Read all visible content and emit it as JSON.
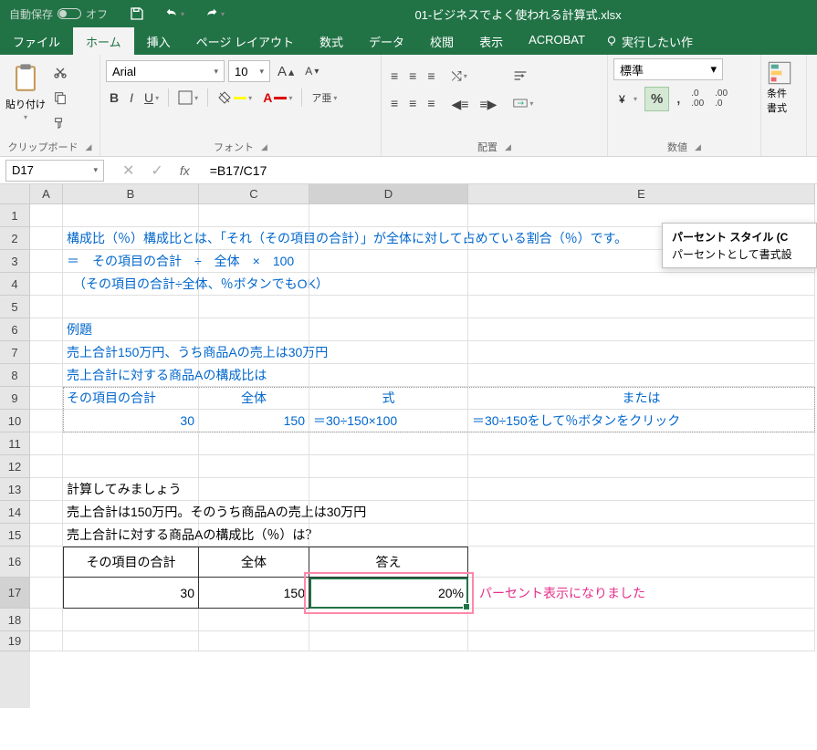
{
  "title_bar": {
    "autosave_label": "自動保存",
    "autosave_state": "オフ",
    "file_title": "01-ビジネスでよく使われる計算式.xlsx"
  },
  "tabs": {
    "file": "ファイル",
    "home": "ホーム",
    "insert": "挿入",
    "page_layout": "ページ レイアウト",
    "formulas": "数式",
    "data": "データ",
    "review": "校閲",
    "view": "表示",
    "acrobat": "ACROBAT",
    "tell_me": "実行したい作"
  },
  "ribbon": {
    "clipboard": {
      "paste": "貼り付け",
      "group": "クリップボード"
    },
    "font": {
      "name": "Arial",
      "size": "10",
      "group": "フォント",
      "ruby": "ア亜"
    },
    "alignment": {
      "group": "配置"
    },
    "number": {
      "format": "標準",
      "group": "数値"
    },
    "cond": {
      "label1": "条件",
      "label2": "書式"
    }
  },
  "tooltip": {
    "title": "パーセント スタイル (C",
    "body": "パーセントとして書式設"
  },
  "formula_bar": {
    "name_box": "D17",
    "formula": "=B17/C17"
  },
  "columns": [
    "A",
    "B",
    "C",
    "D",
    "E"
  ],
  "rows": {
    "r2": "構成比（％）構成比とは、「それ（その項目の合計）」が全体に対して占めている割合（％）です。",
    "r3": "＝　その項目の合計　÷　全体　×　100",
    "r4": "　（その項目の合計÷全体、％ボタンでもOK）",
    "r6": "例題",
    "r7": "売上合計150万円、うち商品Aの売上は30万円",
    "r8": "売上合計に対する商品Aの構成比は",
    "r9": {
      "b": "その項目の合計",
      "c": "全体",
      "d": "式",
      "e": "または"
    },
    "r10": {
      "b": "30",
      "c": "150",
      "d": "＝30÷150×100",
      "e": "＝30÷150をして％ボタンをクリック"
    },
    "r13": "計算してみましょう",
    "r14": "売上合計は150万円。そのうち商品Aの売上は30万円",
    "r15": "売上合計に対する商品Aの構成比（％）は？",
    "r16": {
      "b": "その項目の合計",
      "c": "全体",
      "d": "答え"
    },
    "r17": {
      "b": "30",
      "c": "150",
      "d": "20%",
      "e": "パーセント表示になりました"
    }
  },
  "chart_data": {
    "type": "table",
    "title": "売上合計に対する商品Aの構成比",
    "columns": [
      "その項目の合計",
      "全体",
      "答え"
    ],
    "rows": [
      [
        30,
        150,
        "20%"
      ]
    ]
  }
}
